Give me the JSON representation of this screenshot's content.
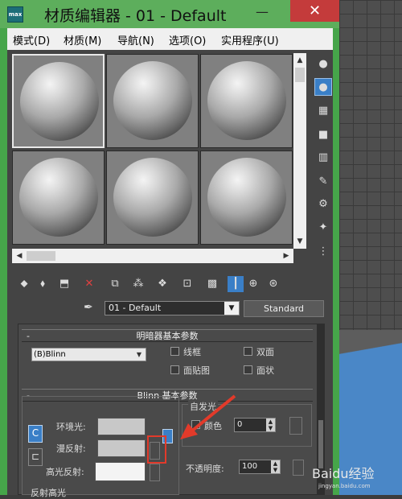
{
  "window": {
    "title": "材质编辑器 - 01 - Default",
    "app_icon_text": "max",
    "minimize": "—",
    "maximize": "☐",
    "close": "✕"
  },
  "menu": [
    "模式(D)",
    "材质(M)",
    "导航(N)",
    "选项(O)",
    "实用程序(U)"
  ],
  "scroll": {
    "up": "▲",
    "down": "▼",
    "left": "◀",
    "right": "▶"
  },
  "material": {
    "picker_icon": "eyedropper-icon",
    "name": "01 - Default",
    "type": "Standard"
  },
  "shader_rollout": {
    "title": "明暗器基本参数",
    "collapse": "-",
    "shader": "(B)Blinn",
    "options": [
      {
        "label": "线框"
      },
      {
        "label": "双面"
      },
      {
        "label": "面贴图"
      },
      {
        "label": "面状"
      }
    ]
  },
  "blinn_rollout": {
    "title": "Blinn 基本参数",
    "collapse": "-",
    "ambient_label": "环境光:",
    "diffuse_label": "漫反射:",
    "specular_label": "高光反射:",
    "lock_icon": "C",
    "self_illum": {
      "title": "自发光",
      "color_label": "颜色",
      "value": "0"
    },
    "opacity_label": "不透明度:",
    "opacity_value": "100",
    "next_rollout": "反射高光"
  },
  "watermark": {
    "text": "Baidu经验",
    "sub": "jingyan.baidu.com"
  },
  "colors": {
    "frame": "#46a54a",
    "close": "#c43b3b",
    "active_tool": "#3a7fc7",
    "highlight": "#e23a2a"
  }
}
